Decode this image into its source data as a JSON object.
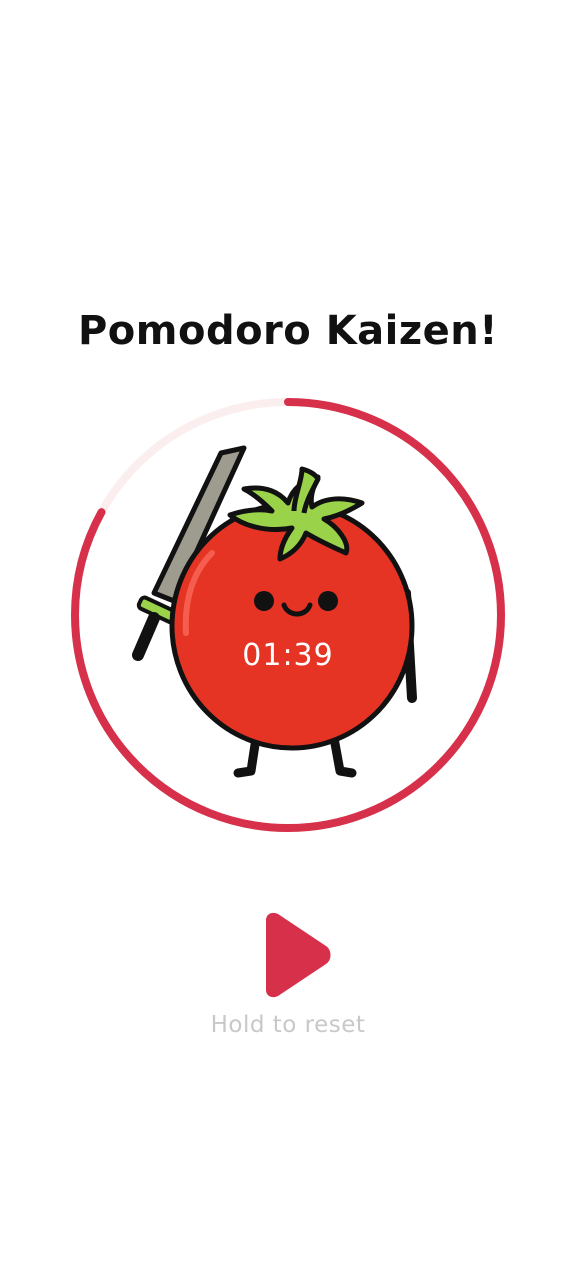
{
  "app": {
    "title": "Pomodoro Kaizen!"
  },
  "timer": {
    "time_remaining": "01:39",
    "progress_elapsed_fraction": 0.17,
    "ring_color": "#d6304a",
    "ring_track_color": "#fbeeee"
  },
  "mascot": {
    "icon": "tomato-samurai-mascot-icon",
    "body_color": "#e53424",
    "leaf_color": "#9ad24a"
  },
  "controls": {
    "play_icon": "play-icon",
    "play_color": "#d6304a",
    "hold_hint": "Hold to reset"
  }
}
